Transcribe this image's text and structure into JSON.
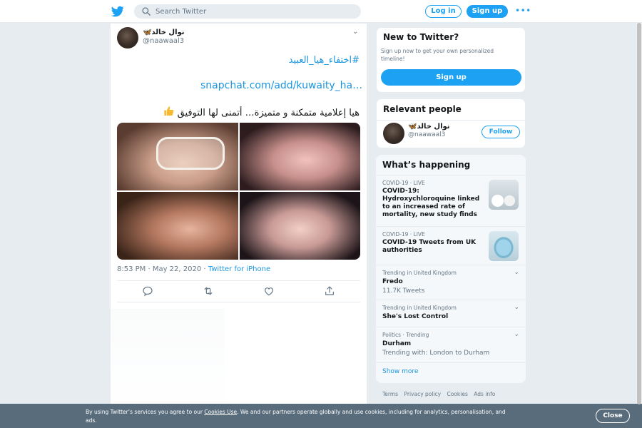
{
  "header": {
    "logo_icon": "twitter-bird-icon",
    "search_placeholder": "Search Twitter",
    "login_label": "Log in",
    "signup_label": "Sign up",
    "more_icon": "more-dots-icon",
    "accent": "#1da1f2"
  },
  "tweet": {
    "user_name": "نوال خالد",
    "user_emoji": "🦋",
    "handle": "@naawaal3",
    "hashtag": "#اختفاء_هيا_العبيد",
    "link": "snapchat.com/add/kuwaity_ha…",
    "text": "هيا  إعلامية متمكنة و متميزة… أتمنى لها التوفيق",
    "timestamp": "8:53 PM · May 22, 2020 · ",
    "source": "Twitter for iPhone",
    "actions": [
      "reply-icon",
      "retweet-icon",
      "like-icon",
      "share-icon"
    ]
  },
  "sidebar": {
    "new_title": "New to Twitter?",
    "new_desc": "Sign up now to get your own personalized timeline!",
    "new_button": "Sign up",
    "relevant_title": "Relevant people",
    "relevant_name": "نوال خالد",
    "relevant_emoji": "🦋",
    "relevant_handle": "@naawaal3",
    "follow_label": "Follow",
    "happening_title": "What’s happening",
    "trends": [
      {
        "context": "COVID-19 · LIVE",
        "title": "COVID-19: Hydroxychloroquine linked to an increased rate of mortality, new study finds",
        "sub": ""
      },
      {
        "context": "COVID-19 · LIVE",
        "title": "COVID-19 Tweets from UK authorities",
        "sub": ""
      },
      {
        "context": "Trending in United Kingdom",
        "title": "Fredo",
        "sub": "11.7K Tweets"
      },
      {
        "context": "Trending in United Kingdom",
        "title": "She's Lost Control",
        "sub": ""
      },
      {
        "context": "Politics · Trending",
        "title": "Durham",
        "sub": "Trending with: London to Durham"
      }
    ],
    "show_more": "Show more"
  },
  "footer": {
    "links": [
      "Terms",
      "Privacy policy",
      "Cookies",
      "Ads info"
    ]
  },
  "cookie": {
    "text_before": "By using Twitter’s services you agree to our ",
    "link": "Cookies Use",
    "text_after": ". We and our partners operate globally and use cookies, including for analytics, personalisation, and ads.",
    "close_label": "Close"
  }
}
